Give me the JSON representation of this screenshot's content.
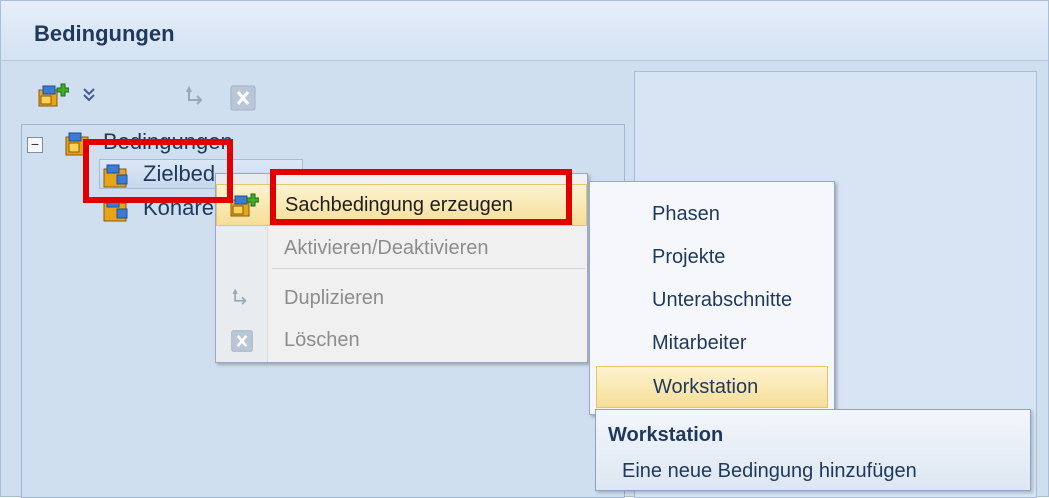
{
  "window": {
    "title": "Bedingungen"
  },
  "toolbar": {
    "add_icon": "add-condition-icon",
    "expand_icon": "double-chevron-down-icon",
    "duplicate_icon": "duplicate-icon",
    "delete_icon": "delete-icon"
  },
  "tree": {
    "root_label": "Bedingungen",
    "children": [
      {
        "label": "Zielbedingungen"
      },
      {
        "label": "Kohärenzbedingungen"
      }
    ],
    "visible_child_1": "Zielbed",
    "visible_child_2": "Kohäre"
  },
  "context_menu": {
    "items": [
      {
        "label": "Sachbedingung erzeugen",
        "disabled": false,
        "has_submenu": true
      },
      {
        "label": "Aktivieren/Deaktivieren",
        "disabled": true
      },
      {
        "label": "Duplizieren",
        "disabled": true
      },
      {
        "label": "Löschen",
        "disabled": true
      }
    ]
  },
  "submenu": {
    "items": [
      {
        "label": "Phasen"
      },
      {
        "label": "Projekte"
      },
      {
        "label": "Unterabschnitte"
      },
      {
        "label": "Mitarbeiter"
      },
      {
        "label": "Workstation"
      }
    ]
  },
  "tooltip": {
    "title": "Workstation",
    "body": "Eine neue Bedingung hinzufügen"
  },
  "colors": {
    "highlight": "#e00000",
    "hover": "#f6de98",
    "title_text": "#1e395b"
  }
}
